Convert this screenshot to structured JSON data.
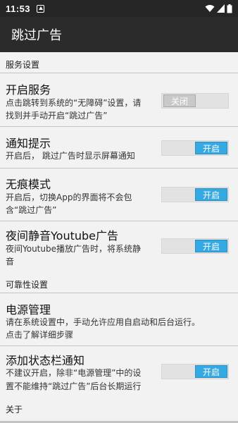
{
  "status_bar": {
    "time": "11:53"
  },
  "app_bar": {
    "title": "跳过广告"
  },
  "sections": {
    "service": "服务设置",
    "reliability": "可靠性设置",
    "about": "关于"
  },
  "prefs": {
    "enable_service": {
      "title": "开启服务",
      "summary_line1": "点击跳转到系统的“无障碍”设置，请",
      "summary_line2": "找到并手动开启“跳过广告”",
      "switch_label": "关闭",
      "switch_on": false
    },
    "notification": {
      "title": "通知提示",
      "summary_line1": "开启后， 跳过广告时显示屏幕通知",
      "switch_label": "开启",
      "switch_on": true
    },
    "incognito": {
      "title": "无痕模式",
      "summary_line1": "开启后，切换App的界面将不会包",
      "summary_line2": "含“跳过广告”",
      "switch_label": "开启",
      "switch_on": true
    },
    "night_mute": {
      "title": "夜间静音Youtube广告",
      "summary_line1": "夜间Youtube播放广告时，将系统静",
      "summary_line2": "音",
      "switch_label": "开启",
      "switch_on": true
    },
    "power_management": {
      "title": "电源管理",
      "summary_line1": "请在系统设置中，手动允许应用自启动和后台运行。",
      "summary_line2": "点击了解详细步骤"
    },
    "status_bar_notification": {
      "title": "添加状态栏通知",
      "summary_line1": "不建议开启，除非“电源管理”中的设",
      "summary_line2": "置不能维持“跳过广告”后台长期运行",
      "switch_label": "开启",
      "switch_on": true
    }
  },
  "colors": {
    "switch_on": "#35a9e1",
    "switch_off": "#c9c9c9",
    "app_bar": "#2b2b2b",
    "background": "#f2f2f2"
  }
}
